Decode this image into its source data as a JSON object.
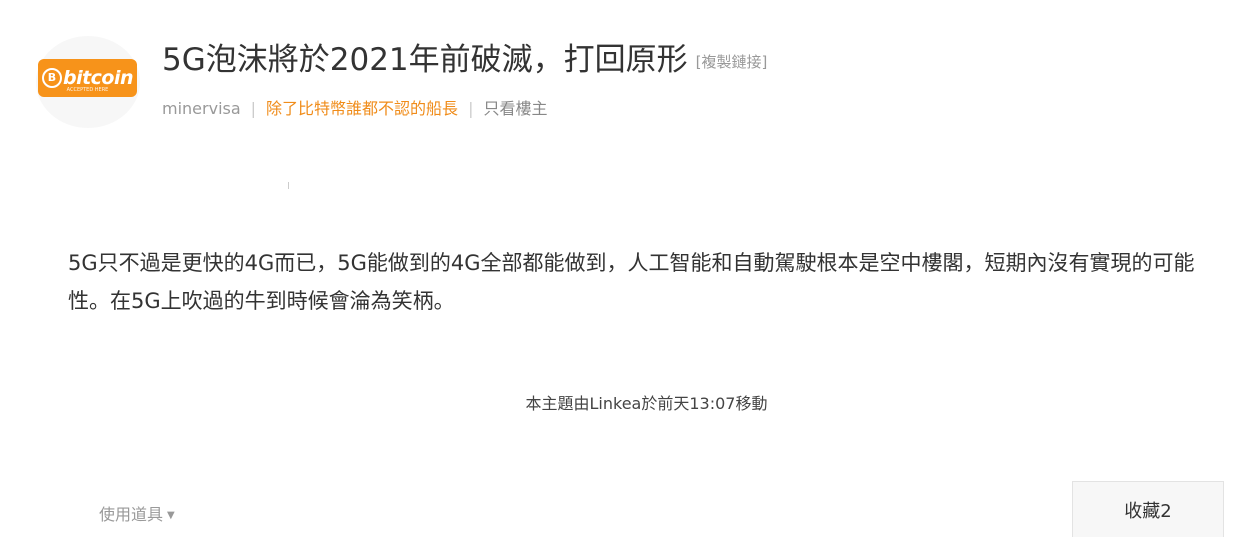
{
  "post": {
    "title": "5G泡沫將於2021年前破滅，打回原形",
    "copy_link_label": "[複製鏈接]",
    "author": "minervisa",
    "separator": "|",
    "author_rank": "除了比特幣誰都不認的船長",
    "only_author_label": "只看樓主",
    "body": "5G只不過是更快的4G而已，5G能做到的4G全部都能做到，人工智能和自動駕駛根本是空中樓閣，短期內沒有實現的可能性。在5G上吹過的牛到時候會淪為笑柄。",
    "moved_note": "本主題由Linkea於前天13:07移動"
  },
  "avatar": {
    "brand_text": "bitcoin",
    "circle_glyph": "B",
    "tagline": "ACCEPTED HERE",
    "color": "#f7931a"
  },
  "footer": {
    "tools_label": "使用道具",
    "tools_caret": "▼",
    "favorite_label": "收藏2"
  },
  "colors": {
    "rank": "#f08c1a",
    "muted": "#999999"
  }
}
